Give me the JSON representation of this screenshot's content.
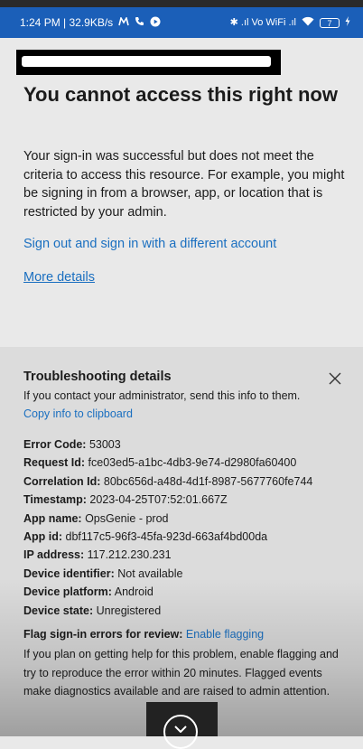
{
  "status_bar": {
    "time_speed": "1:24 PM | 32.9KB/s",
    "right_glyphs": "✱ .ıl Vo WiFi .ıl",
    "battery": "7"
  },
  "content": {
    "title": "You cannot access this right now",
    "description": "Your sign-in was successful but does not meet the criteria to access this resource. For example, you might be signing in from a browser, app, or location that is restricted by your admin.",
    "sign_out_link": "Sign out and sign in with a different account",
    "more_details_link": "More details"
  },
  "troubleshooting": {
    "title": "Troubleshooting details",
    "contact_text": "If you contact your administrator, send this info to them.",
    "copy_link": "Copy info to clipboard",
    "details": [
      {
        "label": "Error Code:",
        "value": "53003"
      },
      {
        "label": "Request Id:",
        "value": "fce03ed5-a1bc-4db3-9e74-d2980fa60400"
      },
      {
        "label": "Correlation Id:",
        "value": "80bc656d-a48d-4d1f-8987-5677760fe744"
      },
      {
        "label": "Timestamp:",
        "value": "2023-04-25T07:52:01.667Z"
      },
      {
        "label": "App name:",
        "value": "OpsGenie - prod"
      },
      {
        "label": "App id:",
        "value": "dbf117c5-96f3-45fa-923d-663af4bd00da"
      },
      {
        "label": "IP address:",
        "value": "117.212.230.231"
      },
      {
        "label": "Device identifier:",
        "value": "Not available"
      },
      {
        "label": "Device platform:",
        "value": "Android"
      },
      {
        "label": "Device state:",
        "value": "Unregistered"
      }
    ],
    "flag_label": "Flag sign-in errors for review:",
    "flag_link": "Enable flagging",
    "flag_description": "If you plan on getting help for this problem, enable flagging and try to reproduce the error within 20 minutes. Flagged events make diagnostics available and are raised to admin attention."
  },
  "icons": {
    "close": "close-icon",
    "minimize": "chevron-down-icon",
    "call": "phone-icon",
    "media": "play-circle-icon",
    "charging": "bolt-icon"
  },
  "colors": {
    "status_bar": "#1b5fb8",
    "link": "#1a6fc0",
    "page_bg": "#e9e9e9",
    "panel_bg": "#dcdcdc"
  }
}
